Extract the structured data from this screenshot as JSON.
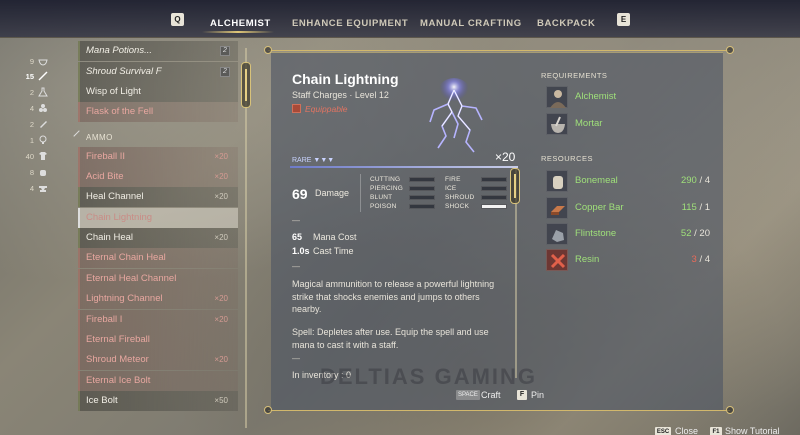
{
  "topbar": {
    "left_key": "Q",
    "right_key": "E",
    "tabs": [
      {
        "label": "ALCHEMIST",
        "active": true
      },
      {
        "label": "ENHANCE EQUIPMENT",
        "active": false
      },
      {
        "label": "MANUAL CRAFTING",
        "active": false
      },
      {
        "label": "BACKPACK",
        "active": false
      }
    ]
  },
  "categories": [
    {
      "count": "9",
      "icon": "bowl-icon"
    },
    {
      "count": "15",
      "icon": "wand-icon",
      "active": true
    },
    {
      "count": "2",
      "icon": "flask-icon"
    },
    {
      "count": "4",
      "icon": "stack-icon"
    },
    {
      "count": "2",
      "icon": "knife-icon"
    },
    {
      "count": "1",
      "icon": "bulb-icon"
    },
    {
      "count": "40",
      "icon": "shirt-icon"
    },
    {
      "count": "8",
      "icon": "pot-icon"
    },
    {
      "count": "4",
      "icon": "anvil-icon"
    }
  ],
  "list": {
    "section_header": "AMMO",
    "items_top": [
      {
        "label": "Mana Potions...",
        "badge": "2",
        "style": "white italic"
      },
      {
        "label": "Shroud Survival F",
        "badge": "2",
        "style": "white italic"
      },
      {
        "label": "Wisp of Light",
        "style": "white"
      },
      {
        "label": "Flask of the Fell",
        "style": "red"
      }
    ],
    "items": [
      {
        "label": "Fireball II",
        "count": "×20",
        "style": "red"
      },
      {
        "label": "Acid Bite",
        "count": "×20",
        "style": "red"
      },
      {
        "label": "Heal Channel",
        "count": "×20",
        "style": "white"
      },
      {
        "label": "Chain Lightning",
        "count": "",
        "style": "selected"
      },
      {
        "label": "Chain Heal",
        "count": "×20",
        "style": "white"
      },
      {
        "label": "Eternal Chain Heal",
        "count": "",
        "style": "red"
      },
      {
        "label": "Eternal Heal Channel",
        "count": "",
        "style": "red"
      },
      {
        "label": "Lightning Channel",
        "count": "×20",
        "style": "red"
      },
      {
        "label": "Fireball I",
        "count": "×20",
        "style": "red"
      },
      {
        "label": "Eternal Fireball",
        "count": "",
        "style": "red"
      },
      {
        "label": "Shroud Meteor",
        "count": "×20",
        "style": "red"
      },
      {
        "label": "Eternal Ice Bolt",
        "count": "",
        "style": "red"
      },
      {
        "label": "Ice Bolt",
        "count": "×50",
        "style": "white"
      }
    ]
  },
  "detail": {
    "title": "Chain Lightning",
    "subtitle": "Staff Charges  ·  Level 12",
    "equippable": "Equippable",
    "rarity": "RARE",
    "rarity_marks": "▼▼▼",
    "stack": "×20",
    "damage_value": "69",
    "damage_label": "Damage",
    "resistances_left": [
      {
        "label": "CUTTING",
        "fill": 0
      },
      {
        "label": "PIERCING",
        "fill": 0
      },
      {
        "label": "BLUNT",
        "fill": 0
      },
      {
        "label": "POISON",
        "fill": 0
      }
    ],
    "resistances_right": [
      {
        "label": "FIRE",
        "fill": 0
      },
      {
        "label": "ICE",
        "fill": 0
      },
      {
        "label": "SHROUD",
        "fill": 0
      },
      {
        "label": "SHOCK",
        "fill": 1
      }
    ],
    "mana_value": "65",
    "mana_label": "Mana Cost",
    "cast_value": "1.0s",
    "cast_label": "Cast Time",
    "desc1": "Magical ammunition to release a powerful lightning strike that shocks enemies and jumps to others nearby.",
    "desc2": "Spell: Depletes after use. Equip the spell and use mana to cast it with a staff.",
    "inventory": "In inventory : 0",
    "dash": "—"
  },
  "requirements": {
    "title": "REQUIREMENTS",
    "items": [
      {
        "name": "Alchemist",
        "icon": "alchemist-icon"
      },
      {
        "name": "Mortar",
        "icon": "mortar-icon"
      }
    ]
  },
  "resources": {
    "title": "RESOURCES",
    "items": [
      {
        "name": "Bonemeal",
        "have": "290",
        "need": "/ 4",
        "icon": "bonemeal-icon",
        "low": false
      },
      {
        "name": "Copper Bar",
        "have": "115",
        "need": "/ 1",
        "icon": "copper-bar-icon",
        "low": false
      },
      {
        "name": "Flintstone",
        "have": "52",
        "need": "/ 20",
        "icon": "flintstone-icon",
        "low": false
      },
      {
        "name": "Resin",
        "have": "3",
        "need": "/ 4",
        "icon": "resin-icon",
        "low": true
      }
    ]
  },
  "actions": {
    "craft_key": "SPACE",
    "craft_label": "Craft",
    "pin_key": "F",
    "pin_label": "Pin"
  },
  "footer": {
    "close_key": "ESC",
    "close_label": "Close",
    "tutorial_key": "F1",
    "tutorial_label": "Show Tutorial"
  },
  "colors": {
    "requirement_ok": "#9fe07a",
    "resource_low": "#e86a5a",
    "accent_gold": "#d2b86c"
  }
}
